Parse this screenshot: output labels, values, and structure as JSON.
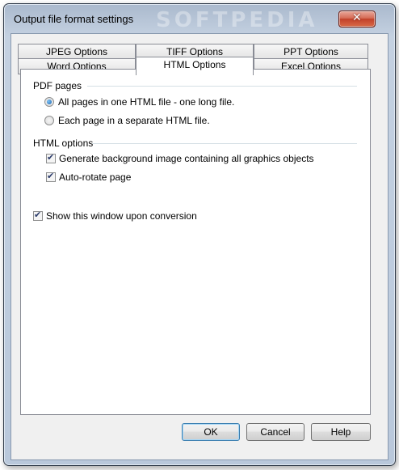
{
  "window": {
    "title": "Output file format settings",
    "watermark": "SOFTPEDIA",
    "close_glyph": "✕"
  },
  "tabs": {
    "row_back": [
      "JPEG Options",
      "TIFF Options",
      "PPT Options"
    ],
    "row_front": [
      "Word Options",
      "HTML Options",
      "Excel Options"
    ],
    "active": "HTML Options"
  },
  "pdf_pages": {
    "label": "PDF pages",
    "options": [
      {
        "label": "All pages in one HTML file - one long file.",
        "selected": true
      },
      {
        "label": "Each page in a separate HTML file.",
        "selected": false
      }
    ]
  },
  "html_options": {
    "label": "HTML options",
    "options": [
      {
        "label": "Generate background image containing all graphics objects",
        "checked": true
      },
      {
        "label": "Auto-rotate page",
        "checked": true
      }
    ]
  },
  "show_window": {
    "label": "Show this window upon conversion",
    "checked": true
  },
  "buttons": {
    "ok": "OK",
    "cancel": "Cancel",
    "help": "Help"
  }
}
